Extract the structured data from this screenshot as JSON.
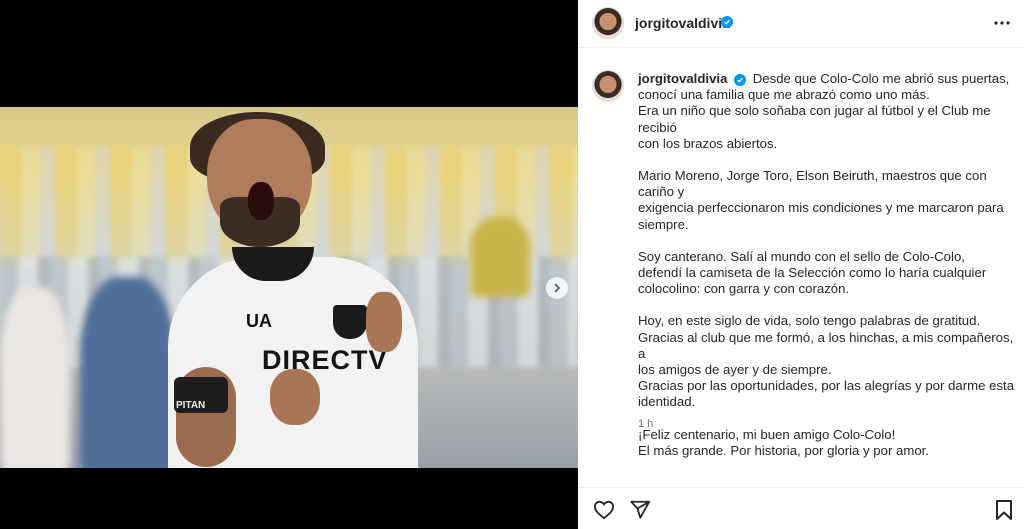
{
  "post": {
    "author": "jorgitovaldivia",
    "verified": true,
    "time": "1 h",
    "caption_paragraphs": [
      [
        "Desde que Colo-Colo me abrió sus puertas,",
        "conocí una familia que me abrazó como uno más.",
        "Era un niño que solo soñaba con jugar al fútbol y el Club me recibió",
        "con los brazos abiertos."
      ],
      [
        "Mario Moreno, Jorge Toro, Elson Beiruth, maestros que con cariño y",
        "exigencia perfeccionaron mis condiciones y me marcaron para",
        "siempre."
      ],
      [
        "Soy canterano. Salí al mundo con el sello de Colo-Colo,",
        "defendí la camiseta de la Selección como lo haría cualquier",
        "colocolino: con garra y con corazón."
      ],
      [
        "Hoy, en este siglo de vida, solo tengo palabras de gratitud.",
        "Gracias al club que me formó, a los hinchas, a mis compañeros, a",
        "los amigos de ayer y de siempre.",
        "Gracias por las oportunidades, por las alegrías y por darme esta",
        "identidad."
      ],
      [
        "¡Feliz centenario, mi buen amigo Colo-Colo!",
        "El más grande. Por historia, por gloria y por amor."
      ]
    ]
  },
  "photo": {
    "jersey_sponsor": "DIRECTV",
    "jersey_brand": "UA",
    "armband_text": "PITAN"
  },
  "icons": {
    "more": "more-options-icon",
    "next": "chevron-right-icon",
    "like": "heart-icon",
    "share": "send-icon",
    "save": "bookmark-icon"
  },
  "colors": {
    "verified_blue": "#0095f6",
    "text": "#262626",
    "muted": "#737373"
  }
}
